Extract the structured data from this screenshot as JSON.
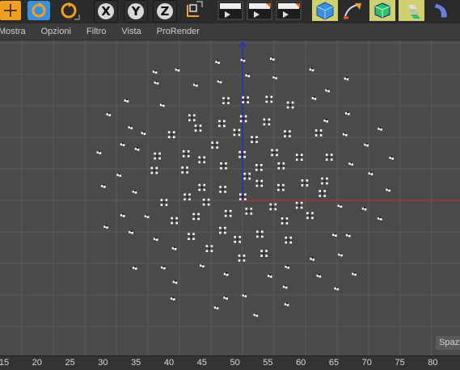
{
  "menu": [
    "Mostra",
    "Opzioni",
    "Filtro",
    "Vista",
    "ProRender"
  ],
  "toolbar": {
    "buttons": [
      {
        "name": "move-tool-icon",
        "type": "tool"
      },
      {
        "name": "rotate-tool-icon",
        "type": "tool"
      },
      {
        "name": "scale-tool-icon",
        "type": "tool"
      },
      {
        "name": "x-axis-lock",
        "label": "X"
      },
      {
        "name": "y-axis-lock",
        "label": "Y"
      },
      {
        "name": "z-axis-lock",
        "label": "Z"
      },
      {
        "name": "coordinate-system-icon",
        "type": "tool"
      },
      {
        "name": "render-view-icon",
        "type": "render"
      },
      {
        "name": "render-picture-viewer-icon",
        "type": "render"
      },
      {
        "name": "render-settings-icon",
        "type": "render"
      },
      {
        "name": "cube-primitive-icon",
        "type": "object"
      },
      {
        "name": "pen-spline-icon",
        "type": "object"
      },
      {
        "name": "subdivision-generator-icon",
        "type": "object"
      },
      {
        "name": "cloner-icon",
        "type": "object"
      },
      {
        "name": "deformer-icon",
        "type": "object"
      }
    ]
  },
  "viewport": {
    "label": "Spazio",
    "colors": {
      "background": "#4a4a4a",
      "grid": "#5a5a5a",
      "x_axis": "#c0282d",
      "y_axis": "#2a2ad0",
      "points": "#ffffff"
    }
  },
  "timeline": {
    "ticks": [
      "15",
      "20",
      "25",
      "30",
      "35",
      "40",
      "45",
      "50",
      "55",
      "60",
      "65",
      "70",
      "75",
      "80"
    ]
  }
}
